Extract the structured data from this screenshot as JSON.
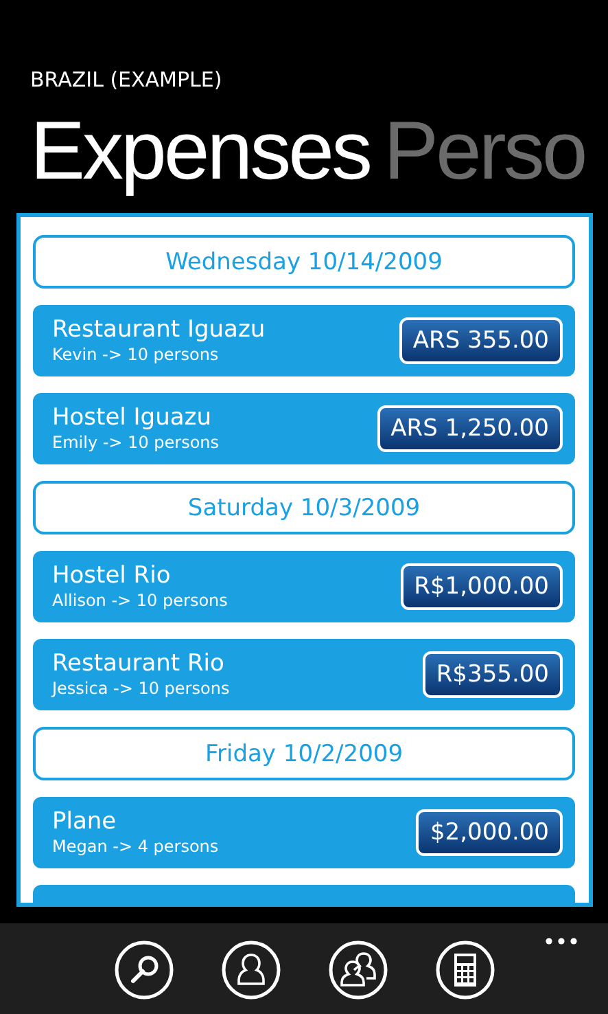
{
  "app_title": "BRAZIL (EXAMPLE)",
  "pivot": [
    {
      "label": "Expenses",
      "selected": true
    },
    {
      "label": "Perso",
      "selected": false
    }
  ],
  "list": [
    {
      "kind": "date",
      "label": "Wednesday 10/14/2009"
    },
    {
      "kind": "expense",
      "title": "Restaurant Iguazu",
      "subtitle": "Kevin -> 10 persons",
      "amount": "ARS 355.00"
    },
    {
      "kind": "expense",
      "title": "Hostel Iguazu",
      "subtitle": "Emily -> 10 persons",
      "amount": "ARS 1,250.00"
    },
    {
      "kind": "date",
      "label": "Saturday 10/3/2009"
    },
    {
      "kind": "expense",
      "title": "Hostel Rio",
      "subtitle": "Allison -> 10 persons",
      "amount": "R$1,000.00"
    },
    {
      "kind": "expense",
      "title": "Restaurant Rio",
      "subtitle": "Jessica -> 10 persons",
      "amount": "R$355.00"
    },
    {
      "kind": "date",
      "label": "Friday 10/2/2009"
    },
    {
      "kind": "expense",
      "title": "Plane",
      "subtitle": "Megan -> 4 persons",
      "amount": "$2,000.00"
    },
    {
      "kind": "partial"
    }
  ]
}
